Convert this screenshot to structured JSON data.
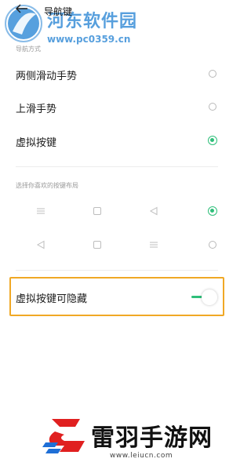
{
  "header": {
    "title": "导航键",
    "back_icon": "arrow-left-icon"
  },
  "watermark": {
    "title": "河东软件园",
    "url": "www.pc0359.cn",
    "color": "#3a8fd8"
  },
  "nav_mode": {
    "section_label": "导航方式",
    "options": [
      {
        "label": "两侧滑动手势",
        "selected": false
      },
      {
        "label": "上滑手势",
        "selected": false
      },
      {
        "label": "虚拟按键",
        "selected": true
      }
    ]
  },
  "layout": {
    "section_label": "选择你喜欢的按键布局",
    "rows": [
      {
        "keys": [
          "menu-icon",
          "square-icon",
          "triangle-left-icon"
        ],
        "selected": true
      },
      {
        "keys": [
          "triangle-left-icon",
          "square-icon",
          "menu-icon"
        ],
        "selected": false
      }
    ]
  },
  "hide_keys": {
    "label": "虚拟按键可隐藏",
    "enabled": true
  },
  "brand": {
    "name": "雷羽手游网",
    "url": "www.leiucn.com"
  },
  "colors": {
    "accent": "#2fbf7a",
    "highlight": "#f0a825"
  }
}
